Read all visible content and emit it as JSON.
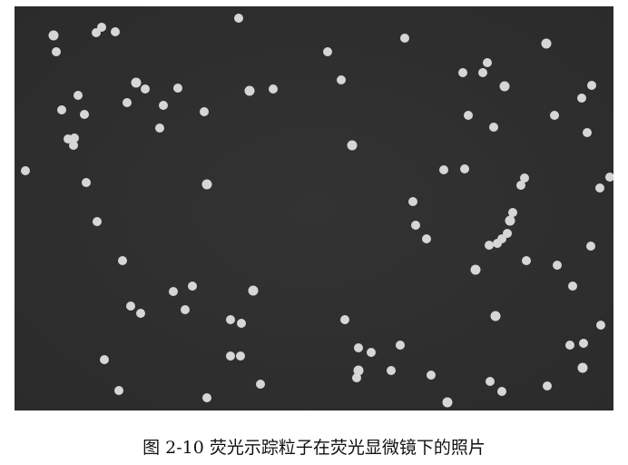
{
  "figure": {
    "caption": "图 2-10  荧光示踪粒子在荧光显微镜下的照片"
  },
  "micrograph": {
    "background_color": "#2f2f2f",
    "particle_color": "#d6d6d6"
  }
}
